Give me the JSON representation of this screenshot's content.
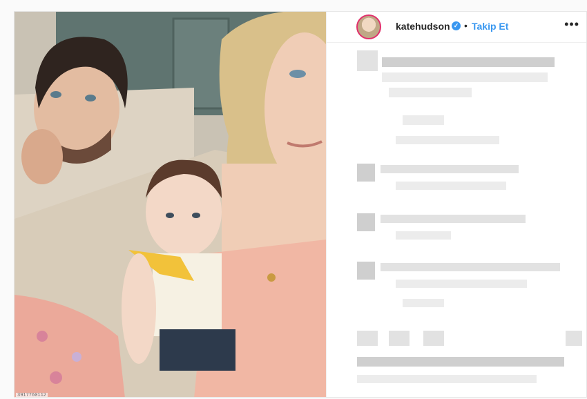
{
  "post": {
    "username": "katehudson",
    "follow_label": "Takip Et",
    "dot": "•",
    "verified_mark": "✓",
    "more_label": "•••"
  },
  "photo": {
    "watermark": "3917760112"
  },
  "icons": {
    "avatar": "profile-avatar",
    "verified": "verified-badge-icon",
    "more": "more-options-icon"
  },
  "colors": {
    "link": "#3897f0",
    "text": "#262626",
    "story_ring": "#e1306c"
  }
}
